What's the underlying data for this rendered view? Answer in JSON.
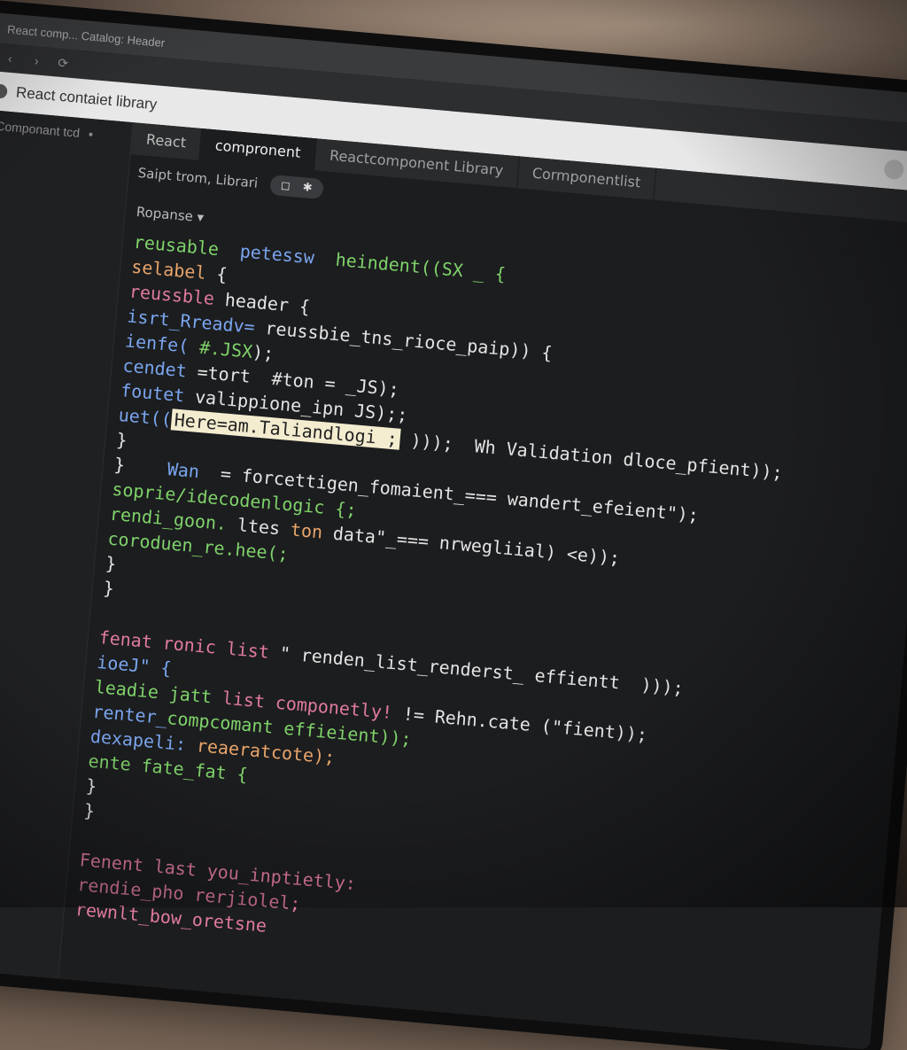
{
  "browser": {
    "tab_title": "React comp... Catalog: Header",
    "back_icon": "chevron-left-icon",
    "forward_icon": "chevron-right-icon",
    "reload_icon": "reload-icon"
  },
  "app": {
    "title": "React contaiet library"
  },
  "sidebar": {
    "back_icon": "chevron-left-icon",
    "label": "Componant tcd",
    "file_icon": "file-icon"
  },
  "tabs": [
    {
      "label": "React"
    },
    {
      "label": "compronent"
    },
    {
      "label": "Reactcomponent Library"
    },
    {
      "label": "Cormponentlist"
    }
  ],
  "toolbar": {
    "breadcrumb": "Saipt trom, Librari",
    "pill_a": "◻",
    "pill_b": "✱"
  },
  "editor": {
    "panel_label": "Ropanse ▾",
    "lines": [
      [
        [
          "reusable  ",
          "green"
        ],
        [
          "petessw  ",
          "blue"
        ],
        [
          "heindent((SX _ {",
          "green"
        ]
      ],
      [
        [
          "selabel ",
          "orange"
        ],
        [
          "{",
          "white"
        ]
      ],
      [
        [
          "reussble ",
          "pink"
        ],
        [
          "header {",
          "white"
        ]
      ],
      [
        [
          "isrt_",
          "blue"
        ],
        [
          "Rreadv= ",
          "blue"
        ],
        [
          "reussbie_tns_rioce_paip",
          "white"
        ],
        [
          ")) {",
          "white"
        ]
      ],
      [
        [
          "ienfe( ",
          "blue"
        ],
        [
          "#.JSX",
          "green"
        ],
        [
          ");",
          "white"
        ]
      ],
      [
        [
          "cendet ",
          "blue"
        ],
        [
          "=tort  ",
          "white"
        ],
        [
          "#ton = _JS);",
          "white"
        ]
      ],
      [
        [
          "foutet ",
          "blue"
        ],
        [
          "valippione_ipn JS);;",
          "white"
        ]
      ],
      [
        [
          "uet((",
          "blue"
        ],
        [
          "Here=am.Taliandlogi ;",
          "highlight"
        ],
        [
          " )));  ",
          "white"
        ],
        [
          "Wh Validation dloce_pfient));",
          "white"
        ]
      ],
      [
        [
          "}",
          "white"
        ]
      ],
      [
        [
          "}    ",
          "white"
        ],
        [
          "Wan  ",
          "blue"
        ],
        [
          "= forcettigen_fomaient_=== wandert_efeient\");",
          "white"
        ]
      ],
      [
        [
          "soprie/idecodenlogic {;",
          "green"
        ]
      ],
      [
        [
          "rendi_goon. ",
          "green"
        ],
        [
          "ltes ",
          "white"
        ],
        [
          "ton ",
          "orange"
        ],
        [
          "data\"_=== nrwegliial) <e));",
          "white"
        ]
      ],
      [
        [
          "coroduen_re.hee(;",
          "green"
        ]
      ],
      [
        [
          "}",
          "white"
        ]
      ],
      [
        [
          "}",
          "white"
        ]
      ],
      [
        [
          "",
          "white"
        ]
      ],
      [
        [
          "fenat ",
          "pink"
        ],
        [
          "ronic list ",
          "pink"
        ],
        [
          "\" renden_list_renderst_ effientt  )));",
          "white"
        ]
      ],
      [
        [
          "ioeJ\" {",
          "blue"
        ]
      ],
      [
        [
          "leadie ",
          "green"
        ],
        [
          "jatt ",
          "green"
        ],
        [
          "list ",
          "pink"
        ],
        [
          "componetly! ",
          "pink"
        ],
        [
          "!= Rehn.cate (\"fient));",
          "white"
        ]
      ],
      [
        [
          "renter_",
          "blue"
        ],
        [
          "compcomant ",
          "green"
        ],
        [
          "effieient));",
          "green"
        ]
      ],
      [
        [
          "dexapeli: ",
          "blue"
        ],
        [
          "reaeratcote);",
          "orange"
        ]
      ],
      [
        [
          "ente ",
          "green"
        ],
        [
          "fate_fat {",
          "green"
        ]
      ],
      [
        [
          "}",
          "white"
        ]
      ],
      [
        [
          "}",
          "white"
        ]
      ],
      [
        [
          "",
          "white"
        ]
      ],
      [
        [
          "Fenent ",
          "pink"
        ],
        [
          "last ",
          "pink"
        ],
        [
          "you_inptietly:",
          "pink"
        ]
      ],
      [
        [
          "rendie_pho ",
          "pink"
        ],
        [
          "rerjiolel;",
          "pink"
        ]
      ],
      [
        [
          "rewnlt_bow_oretsne",
          "pink"
        ]
      ]
    ]
  }
}
